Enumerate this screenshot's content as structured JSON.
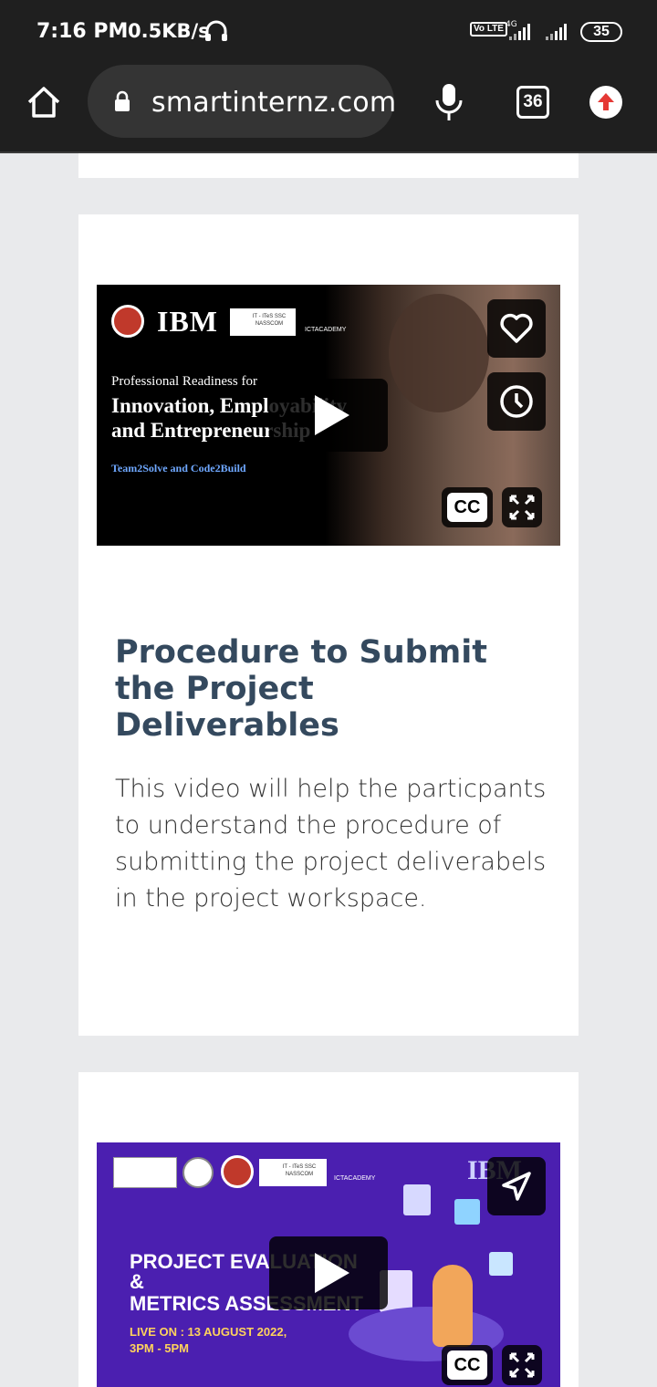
{
  "status": {
    "time": "7:16 PM",
    "speed": "0.5KB/s",
    "volte": "Vo LTE",
    "net_label": "4G",
    "battery": "35"
  },
  "browser": {
    "url": "smartinternz.com",
    "tab_count": "36"
  },
  "video1": {
    "logo_ibm": "IBM",
    "logo_nasscom": "IT - ITeS SSC NASSCOM",
    "logo_ict": "ICTACADEMY",
    "line1": "Professional Readiness for",
    "line2": "Innovation, Employability",
    "line3": "and Entrepreneurship",
    "line4": "Team2Solve and Code2Build",
    "cc": "CC"
  },
  "main": {
    "title": "Procedure to Submit the Project Deliverables",
    "description": "This video will help the particpants to understand the procedure of submitting the project deliverabels in the project workspace."
  },
  "video2": {
    "logo_nasscom": "IT - ITeS SSC NASSCOM",
    "logo_ict": "ICTACADEMY",
    "logo_ibm": "IBM",
    "headline1": "PROJECT EVALUATION",
    "headline2": "&",
    "headline3": "METRICS ASSESSMENT",
    "live1": "LIVE ON : 13 AUGUST 2022,",
    "live2": "3PM - 5PM",
    "cc": "CC"
  },
  "colors": {
    "title": "#34495e",
    "bars": "#1f1f1f",
    "page_bg": "#e9eaec",
    "video2_bg": "#4b1fb0",
    "update_arrow": "#e53935"
  }
}
